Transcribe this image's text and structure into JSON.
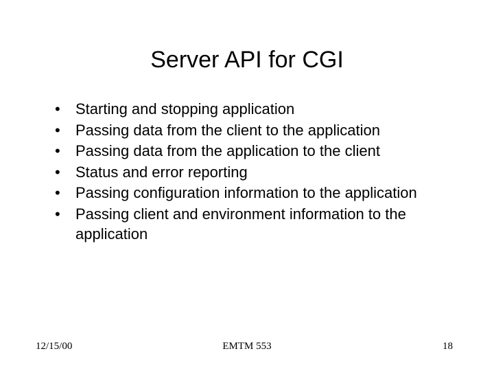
{
  "title": "Server API for CGI",
  "bullets": [
    "Starting and stopping application",
    "Passing data from the client to the application",
    "Passing data from the application to the client",
    "Status and error reporting",
    "Passing configuration information to the application",
    "Passing client and environment information to the application"
  ],
  "footer": {
    "date": "12/15/00",
    "course": "EMTM 553",
    "page": "18"
  }
}
